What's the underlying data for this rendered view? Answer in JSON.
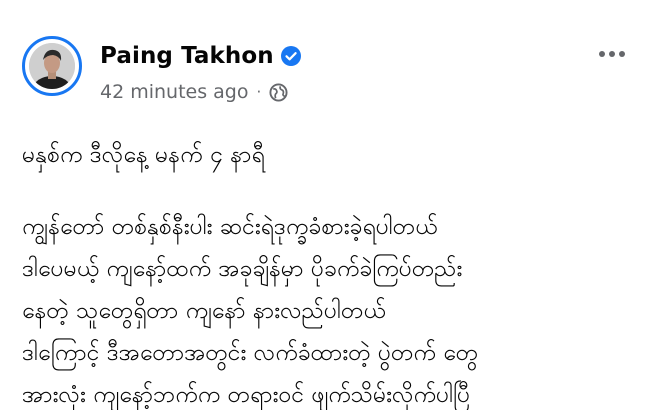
{
  "post": {
    "author": "Paing Takhon",
    "timestamp": "42 minutes ago",
    "separator": "·",
    "audience_icon": "globe-icon",
    "verified_icon": "verified-badge-icon",
    "more_icon": "more-options-icon",
    "lines": [
      "မနှစ်က ဒီလိုနေ့ မနက် ၄ နာရီ",
      "ကျွန်တော် တစ်နှစ်နီးပါး ဆင်းရဲဒုက္ခခံစားခဲ့ရပါတယ်",
      "ဒါပေမယ့် ကျနော့်ထက် အခုချိန်မှာ ပိုခက်ခဲကြပ်တည်း",
      "နေတဲ့ သူတွေရှိတာ ကျနော် နားလည်ပါတယ်",
      "ဒါကြောင့် ဒီအတောအတွင်း လက်ခံထားတဲ့ ပွဲတက် တွေ",
      "အားလုံး ကျနော့်ဘက်က တရားဝင် ဖျက်သိမ်းလိုက်ပါပြီ"
    ]
  },
  "colors": {
    "accent": "#1877f2",
    "text_primary": "#050505",
    "text_secondary": "#65676b"
  }
}
